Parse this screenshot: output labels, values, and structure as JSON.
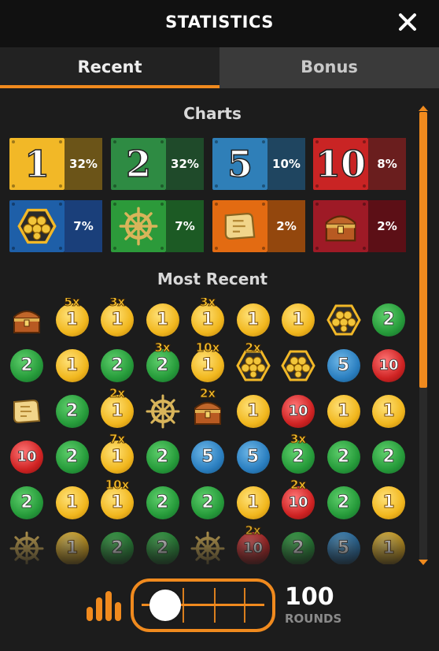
{
  "header": {
    "title": "STATISTICS",
    "close_icon": "close-icon"
  },
  "tabs": [
    {
      "label": "Recent",
      "active": true
    },
    {
      "label": "Bonus",
      "active": false
    }
  ],
  "charts": {
    "title": "Charts",
    "items": [
      {
        "segment": "1",
        "percent": "32%",
        "icon_bg": "#f2b827",
        "pct_bg": "#6b5418"
      },
      {
        "segment": "2",
        "percent": "32%",
        "icon_bg": "#2e8b43",
        "pct_bg": "#1f4a2a"
      },
      {
        "segment": "5",
        "percent": "10%",
        "icon_bg": "#2f7fb8",
        "pct_bg": "#1f4560"
      },
      {
        "segment": "10",
        "percent": "8%",
        "icon_bg": "#c92424",
        "pct_bg": "#6a1e1e"
      },
      {
        "segment": "coin-flip-icon",
        "percent": "7%",
        "icon_bg": "#1e5fa8",
        "pct_bg": "#1a3f7a"
      },
      {
        "segment": "ship-wheel-icon",
        "percent": "7%",
        "icon_bg": "#2c9a3a",
        "pct_bg": "#1c5a24"
      },
      {
        "segment": "treasure-map-icon",
        "percent": "2%",
        "icon_bg": "#e36b12",
        "pct_bg": "#93470d"
      },
      {
        "segment": "treasure-chest-icon",
        "percent": "2%",
        "icon_bg": "#9e1a26",
        "pct_bg": "#5c0f16"
      }
    ]
  },
  "most_recent": {
    "title": "Most Recent",
    "rows": [
      [
        {
          "v": "chest"
        },
        {
          "v": "1",
          "m": "5x"
        },
        {
          "v": "1",
          "m": "3x"
        },
        {
          "v": "1"
        },
        {
          "v": "1",
          "m": "3x"
        },
        {
          "v": "1"
        },
        {
          "v": "1"
        },
        {
          "v": "coins"
        },
        {
          "v": "2"
        }
      ],
      [
        {
          "v": "2"
        },
        {
          "v": "1"
        },
        {
          "v": "2"
        },
        {
          "v": "2",
          "m": "3x"
        },
        {
          "v": "1",
          "m": "10x"
        },
        {
          "v": "coins",
          "m": "2x"
        },
        {
          "v": "coins"
        },
        {
          "v": "5"
        },
        {
          "v": "10"
        }
      ],
      [
        {
          "v": "map"
        },
        {
          "v": "2"
        },
        {
          "v": "1",
          "m": "2x"
        },
        {
          "v": "wheel"
        },
        {
          "v": "chest",
          "m": "2x"
        },
        {
          "v": "1"
        },
        {
          "v": "10"
        },
        {
          "v": "1"
        },
        {
          "v": "1"
        }
      ],
      [
        {
          "v": "10"
        },
        {
          "v": "2"
        },
        {
          "v": "1",
          "m": "7x"
        },
        {
          "v": "2"
        },
        {
          "v": "5"
        },
        {
          "v": "5"
        },
        {
          "v": "2",
          "m": "3x"
        },
        {
          "v": "2"
        },
        {
          "v": "2"
        }
      ],
      [
        {
          "v": "2"
        },
        {
          "v": "1"
        },
        {
          "v": "1",
          "m": "10x"
        },
        {
          "v": "2"
        },
        {
          "v": "2"
        },
        {
          "v": "1"
        },
        {
          "v": "10",
          "m": "2x"
        },
        {
          "v": "2"
        },
        {
          "v": "1"
        }
      ],
      [
        {
          "v": "wheel"
        },
        {
          "v": "1"
        },
        {
          "v": "2"
        },
        {
          "v": "2"
        },
        {
          "v": "wheel"
        },
        {
          "v": "10",
          "m": "2x"
        },
        {
          "v": "2"
        },
        {
          "v": "5"
        },
        {
          "v": "1"
        }
      ]
    ]
  },
  "footer": {
    "rounds_value": "100",
    "rounds_label": "ROUNDS",
    "slider_position": 0,
    "accent": "#f08a1e"
  }
}
